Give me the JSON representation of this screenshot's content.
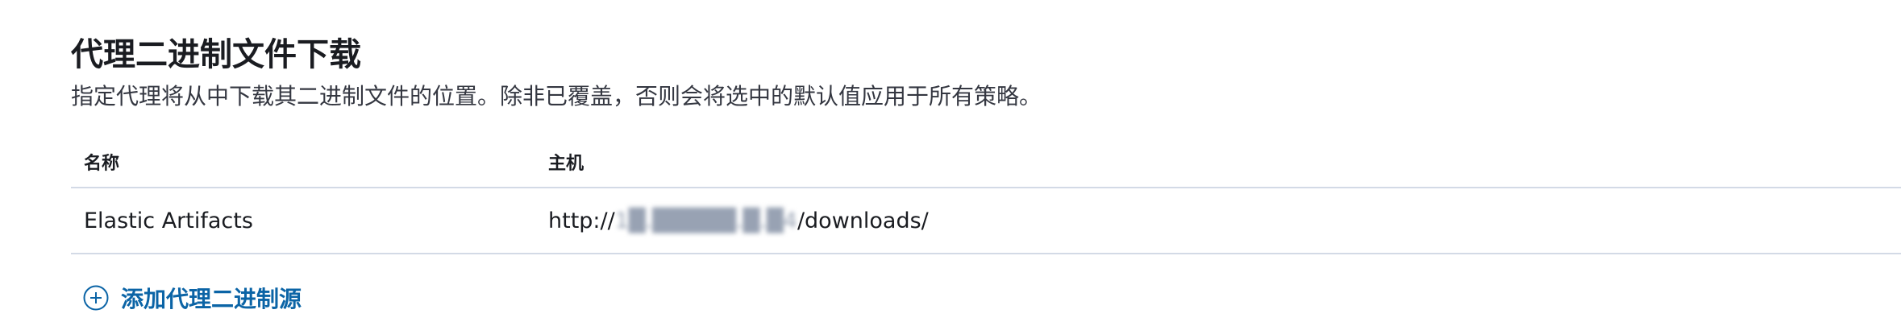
{
  "section": {
    "title": "代理二进制文件下载",
    "description": "指定代理将从中下载其二进制文件的位置。除非已覆盖，否则会将选中的默认值应用于所有策略。"
  },
  "table": {
    "columns": [
      "名称",
      "主机"
    ],
    "rows": [
      {
        "name": "Elastic Artifacts",
        "host_prefix": "http://",
        "host_redacted": "1█.█████.█.█4",
        "host_suffix": "/downloads/"
      }
    ]
  },
  "actions": {
    "add_label": "添加代理二进制源",
    "add_icon": "plus-circle-icon"
  },
  "colors": {
    "link": "#0b64a6",
    "divider": "#d3dae6",
    "text": "#1a1c21"
  }
}
